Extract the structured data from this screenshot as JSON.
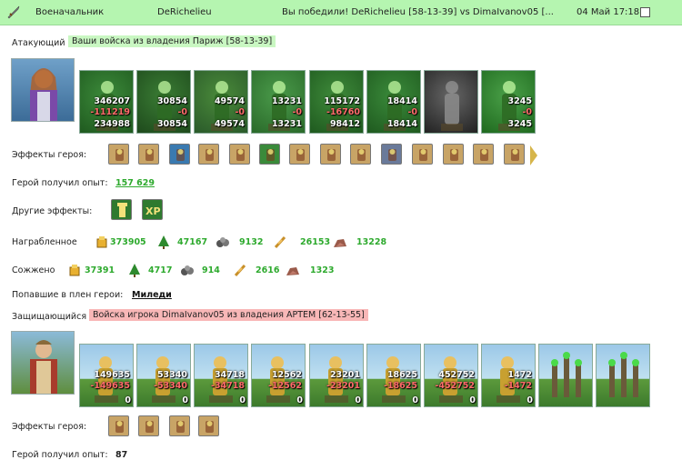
{
  "header": {
    "col1": "Военачальник",
    "col2": "DeRichelieu",
    "col3": "Вы победили! DeRichelieu [58-13-39] vs DimaIvanov05 [...",
    "col4": "04 Май 17:18"
  },
  "attacker": {
    "label": "Атакующий",
    "tag": "Ваши войска из владения Париж [58-13-39]",
    "units": [
      {
        "top": "346207",
        "lost": "-111219",
        "left": "234988"
      },
      {
        "top": "30854",
        "lost": "-0",
        "left": "30854"
      },
      {
        "top": "49574",
        "lost": "-0",
        "left": "49574"
      },
      {
        "top": "13231",
        "lost": "-0",
        "left": "13231"
      },
      {
        "top": "115172",
        "lost": "-16760",
        "left": "98412"
      },
      {
        "top": "18414",
        "lost": "-0",
        "left": "18414"
      },
      {
        "top": "",
        "lost": "",
        "left": ""
      },
      {
        "top": "3245",
        "lost": "-0",
        "left": "3245"
      }
    ],
    "effects_label": "Эффекты героя:",
    "exp_label": "Герой получил опыт:",
    "exp_value": "157 629",
    "other_label": "Другие эффекты:",
    "loot_label": "Награбленное",
    "loot": [
      "373905",
      "47167",
      "9132",
      "26153",
      "13228"
    ],
    "burned_label": "Сожжено",
    "burned": [
      "37391",
      "4717",
      "914",
      "2616",
      "1323"
    ],
    "captured_label": "Попавшие в плен герои:",
    "captured_value": "Миледи"
  },
  "defender": {
    "label": "Защищающийся",
    "tag": "Войска игрока DimaIvanov05 из владения APTEM [62-13-55]",
    "units": [
      {
        "top": "149635",
        "lost": "-149635",
        "left": "0"
      },
      {
        "top": "53340",
        "lost": "-53340",
        "left": "0"
      },
      {
        "top": "34718",
        "lost": "-34718",
        "left": "0"
      },
      {
        "top": "12562",
        "lost": "-12562",
        "left": "0"
      },
      {
        "top": "23201",
        "lost": "-23201",
        "left": "0"
      },
      {
        "top": "18625",
        "lost": "-18625",
        "left": "0"
      },
      {
        "top": "452752",
        "lost": "-452752",
        "left": "0"
      },
      {
        "top": "1472",
        "lost": "-1472",
        "left": "0"
      },
      {
        "top": "",
        "lost": "",
        "left": ""
      },
      {
        "top": "",
        "lost": "",
        "left": ""
      }
    ],
    "effects_label": "Эффекты героя:",
    "exp_label": "Герой получил опыт:",
    "exp_value": "87"
  },
  "icons": {
    "other_effect_1": "tower-icon",
    "other_effect_2": "xp-icon",
    "resources": [
      "gold-icon",
      "wood-icon",
      "ore-icon",
      "grain-icon",
      "stone-icon"
    ]
  }
}
